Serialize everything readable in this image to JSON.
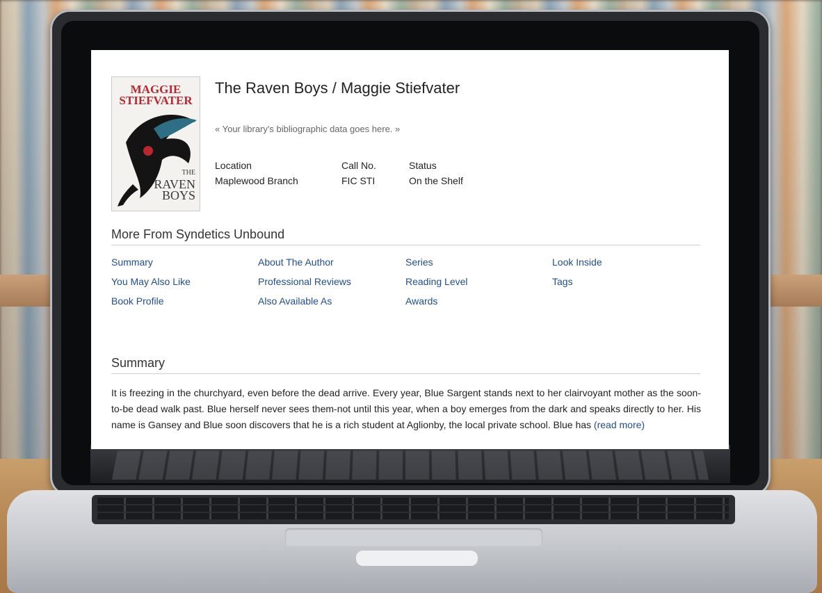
{
  "book": {
    "title": "The Raven Boys / Maggie Stiefvater",
    "biblio_placeholder": "« Your library's bibliographic data goes here. »",
    "cover": {
      "author": "MAGGIE STIEFVATER",
      "title_small": "THE",
      "title_main": "RAVEN",
      "title_sub": "BOYS"
    }
  },
  "holdings": {
    "location_label": "Location",
    "location_value": "Maplewood Branch",
    "callno_label": "Call No.",
    "callno_value": "FIC STI",
    "status_label": "Status",
    "status_value": "On the Shelf"
  },
  "more_from": {
    "heading": "More From Syndetics Unbound",
    "links": [
      [
        "Summary",
        "You May Also Like",
        "Book Profile"
      ],
      [
        "About The Author",
        "Professional Reviews",
        "Also Available As"
      ],
      [
        "Series",
        "Reading Level",
        "Awards"
      ],
      [
        "Look Inside",
        "Tags"
      ]
    ]
  },
  "summary": {
    "heading": "Summary",
    "text": "It is freezing in the churchyard, even before the dead arrive. Every year, Blue Sargent stands next to her clairvoyant mother as the soon-to-be dead walk past. Blue herself never sees them-not until this year, when a boy emerges from the dark and speaks directly to her. His name is Gansey and Blue soon discovers that he is a rich student at Aglionby, the local private school. Blue has",
    "read_more": "(read more)"
  },
  "colors": {
    "link": "#1f4d8f",
    "cover_red": "#b8272d"
  }
}
